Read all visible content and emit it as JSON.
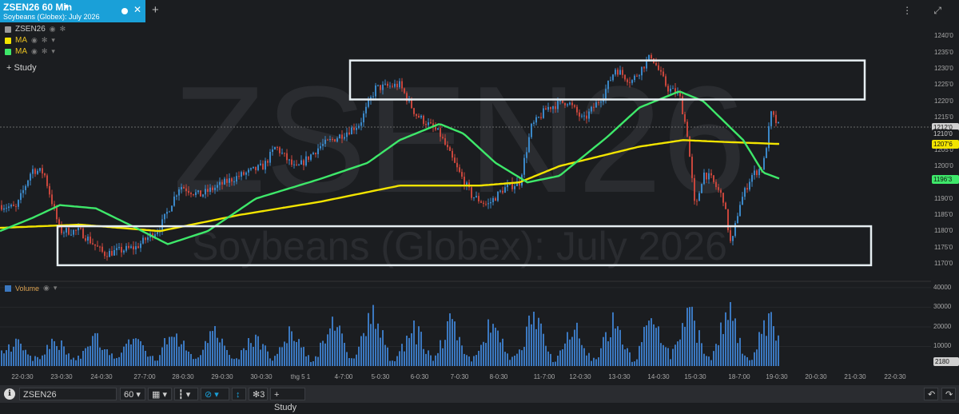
{
  "tab": {
    "title": "ZSEN26 60 Min",
    "subtitle": "Soybeans (Globex): July 2026",
    "dropdown": "▼",
    "close": "✕",
    "add": "+"
  },
  "window_buttons": "⋮ ⤢",
  "watermark": {
    "symbol": "ZSEN26",
    "name": "Soybeans (Globex): July 2026"
  },
  "legend": [
    {
      "label": "ZSEN26",
      "color": "#9a9a9a"
    },
    {
      "label": "MA",
      "color": "#f2e400"
    },
    {
      "label": "MA",
      "color": "#3ee86a"
    }
  ],
  "study_button": "+ Study",
  "volume_label": "Volume",
  "colors": {
    "up": "#3b88c8",
    "down": "#c8463c",
    "ma_slow": "#f2e400",
    "ma_fast": "#3ee86a",
    "volume": "#3b78c0",
    "box": "#e6eef2",
    "accent": "#1aa0d8"
  },
  "price_tags": {
    "last": "1212'0",
    "mid": "1210'0",
    "ma_slow": "1207'6",
    "ma_fast": "1196'3"
  },
  "volume_tag": "2180",
  "bottom_bar": {
    "info_icon": "ℹ",
    "symbol": "ZSEN26",
    "interval": "60",
    "caret": "▾",
    "study_count": "3",
    "study_button": "+ Study",
    "undo": "↶",
    "redo": "↷"
  },
  "chart_data": {
    "type": "candlestick",
    "price_axis": {
      "ylim": [
        1167.5,
        1242.5
      ],
      "ticks": [
        "1240'0",
        "1235'0",
        "1230'0",
        "1225'0",
        "1220'0",
        "1215'0",
        "1210'0",
        "1205'0",
        "1200'0",
        "1195'0",
        "1190'0",
        "1185'0",
        "1180'0",
        "1175'0",
        "1170'0"
      ],
      "tick_values": [
        1240,
        1235,
        1230,
        1225,
        1220,
        1215,
        1210,
        1205,
        1200,
        1195,
        1190,
        1185,
        1180,
        1175,
        1170
      ]
    },
    "volume_axis": {
      "ylim": [
        0,
        42000
      ],
      "ticks": [
        "40000",
        "30000",
        "20000",
        "10000"
      ],
      "tick_values": [
        40000,
        30000,
        20000,
        10000
      ]
    },
    "x_ticks": [
      "22-0:30",
      "23-0:30",
      "24-0:30",
      "27-7:00",
      "28-0:30",
      "29-0:30",
      "30-0:30",
      "thg 5 1",
      "4-7:00",
      "5-0:30",
      "6-0:30",
      "7-0:30",
      "8-0:30",
      "11-7:00",
      "12-0:30",
      "13-0:30",
      "14-0:30",
      "15-0:30",
      "18-7:00",
      "19-0:30",
      "20-0:30",
      "21-0:30",
      "22-0:30"
    ],
    "price_path": [
      [
        0,
        1188
      ],
      [
        20,
        1187
      ],
      [
        40,
        1199
      ],
      [
        55,
        1198
      ],
      [
        75,
        1180
      ],
      [
        100,
        1180
      ],
      [
        130,
        1173
      ],
      [
        170,
        1175
      ],
      [
        200,
        1181
      ],
      [
        225,
        1194
      ],
      [
        250,
        1191
      ],
      [
        290,
        1196
      ],
      [
        330,
        1200
      ],
      [
        345,
        1206
      ],
      [
        370,
        1199
      ],
      [
        400,
        1206
      ],
      [
        430,
        1210
      ],
      [
        450,
        1213
      ],
      [
        470,
        1224
      ],
      [
        500,
        1225
      ],
      [
        520,
        1216
      ],
      [
        550,
        1210
      ],
      [
        570,
        1200
      ],
      [
        590,
        1191
      ],
      [
        610,
        1188
      ],
      [
        630,
        1193
      ],
      [
        650,
        1195
      ],
      [
        665,
        1212
      ],
      [
        685,
        1218
      ],
      [
        710,
        1220
      ],
      [
        730,
        1214
      ],
      [
        755,
        1222
      ],
      [
        770,
        1230
      ],
      [
        790,
        1226
      ],
      [
        815,
        1234
      ],
      [
        835,
        1224
      ],
      [
        850,
        1222
      ],
      [
        860,
        1210
      ],
      [
        870,
        1186
      ],
      [
        880,
        1198
      ],
      [
        890,
        1196
      ],
      [
        905,
        1190
      ],
      [
        915,
        1175
      ],
      [
        925,
        1188
      ],
      [
        940,
        1197
      ],
      [
        955,
        1200
      ],
      [
        965,
        1216
      ],
      [
        975,
        1212
      ]
    ],
    "ma_slow": [
      [
        0,
        1181
      ],
      [
        100,
        1182
      ],
      [
        200,
        1180
      ],
      [
        300,
        1185
      ],
      [
        400,
        1189
      ],
      [
        500,
        1194
      ],
      [
        600,
        1194
      ],
      [
        650,
        1195
      ],
      [
        700,
        1200
      ],
      [
        800,
        1206
      ],
      [
        855,
        1208
      ],
      [
        900,
        1207.5
      ],
      [
        977,
        1206.8
      ]
    ],
    "ma_fast": [
      [
        0,
        1180
      ],
      [
        40,
        1184
      ],
      [
        75,
        1188
      ],
      [
        120,
        1187
      ],
      [
        170,
        1181
      ],
      [
        210,
        1176
      ],
      [
        260,
        1180
      ],
      [
        320,
        1190
      ],
      [
        400,
        1196
      ],
      [
        460,
        1201
      ],
      [
        500,
        1208
      ],
      [
        550,
        1213
      ],
      [
        580,
        1210
      ],
      [
        620,
        1201
      ],
      [
        660,
        1195
      ],
      [
        700,
        1197
      ],
      [
        760,
        1209
      ],
      [
        800,
        1218
      ],
      [
        850,
        1223
      ],
      [
        880,
        1220
      ],
      [
        930,
        1208
      ],
      [
        955,
        1198
      ],
      [
        977,
        1196
      ]
    ],
    "boxes": [
      {
        "price_top": 1232.5,
        "price_bottom": 1220.5
      },
      {
        "price_top": 1181.5,
        "price_bottom": 1169.5
      }
    ]
  }
}
